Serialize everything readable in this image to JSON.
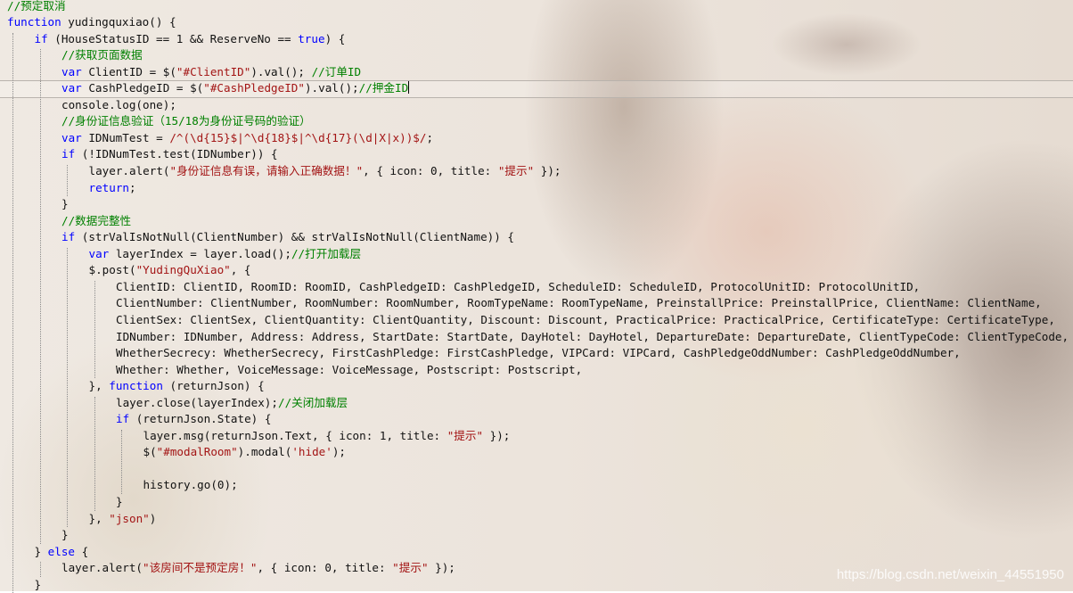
{
  "code_lines": [
    {
      "indent": 0,
      "segs": [
        {
          "t": "//预定取消",
          "c": "cm"
        }
      ]
    },
    {
      "indent": 0,
      "segs": [
        {
          "t": "function",
          "c": "kw"
        },
        {
          "t": " yudingquxiao() {",
          "c": "tx"
        }
      ]
    },
    {
      "indent": 1,
      "segs": [
        {
          "t": "if",
          "c": "kw"
        },
        {
          "t": " (HouseStatusID == 1 && ReserveNo == ",
          "c": "tx"
        },
        {
          "t": "true",
          "c": "kw"
        },
        {
          "t": ") {",
          "c": "tx"
        }
      ]
    },
    {
      "indent": 2,
      "segs": [
        {
          "t": "//获取页面数据",
          "c": "cm"
        }
      ]
    },
    {
      "indent": 2,
      "segs": [
        {
          "t": "var",
          "c": "kw"
        },
        {
          "t": " ClientID = $(",
          "c": "tx"
        },
        {
          "t": "\"#ClientID\"",
          "c": "st"
        },
        {
          "t": ").val(); ",
          "c": "tx"
        },
        {
          "t": "//订单ID",
          "c": "cm"
        }
      ]
    },
    {
      "indent": 2,
      "segs": [
        {
          "t": "var",
          "c": "kw"
        },
        {
          "t": " CashPledgeID = $(",
          "c": "tx"
        },
        {
          "t": "\"#CashPledgeID\"",
          "c": "st"
        },
        {
          "t": ").val();",
          "c": "tx"
        },
        {
          "t": "//押金ID",
          "c": "cm"
        }
      ]
    },
    {
      "indent": 2,
      "segs": [
        {
          "t": "console.log(one);",
          "c": "tx"
        }
      ]
    },
    {
      "indent": 2,
      "segs": [
        {
          "t": "//身份证信息验证（15/18为身份证号码的验证）",
          "c": "cm"
        }
      ]
    },
    {
      "indent": 2,
      "segs": [
        {
          "t": "var",
          "c": "kw"
        },
        {
          "t": " IDNumTest = ",
          "c": "tx"
        },
        {
          "t": "/^(\\d{15}$|^\\d{18}$|^\\d{17}(\\d|X|x))$/",
          "c": "st"
        },
        {
          "t": ";",
          "c": "tx"
        }
      ]
    },
    {
      "indent": 2,
      "segs": [
        {
          "t": "if",
          "c": "kw"
        },
        {
          "t": " (!IDNumTest.test(IDNumber)) {",
          "c": "tx"
        }
      ]
    },
    {
      "indent": 3,
      "segs": [
        {
          "t": "layer.alert(",
          "c": "tx"
        },
        {
          "t": "\"身份证信息有误，请输入正确数据！\"",
          "c": "st"
        },
        {
          "t": ", { icon: 0, title: ",
          "c": "tx"
        },
        {
          "t": "\"提示\"",
          "c": "st"
        },
        {
          "t": " });",
          "c": "tx"
        }
      ]
    },
    {
      "indent": 3,
      "segs": [
        {
          "t": "return",
          "c": "kw"
        },
        {
          "t": ";",
          "c": "tx"
        }
      ]
    },
    {
      "indent": 2,
      "segs": [
        {
          "t": "}",
          "c": "tx"
        }
      ]
    },
    {
      "indent": 2,
      "segs": [
        {
          "t": "//数据完整性",
          "c": "cm"
        }
      ]
    },
    {
      "indent": 2,
      "segs": [
        {
          "t": "if",
          "c": "kw"
        },
        {
          "t": " (strValIsNotNull(ClientNumber) && strValIsNotNull(ClientName)) {",
          "c": "tx"
        }
      ]
    },
    {
      "indent": 3,
      "segs": [
        {
          "t": "var",
          "c": "kw"
        },
        {
          "t": " layerIndex = layer.load();",
          "c": "tx"
        },
        {
          "t": "//打开加载层",
          "c": "cm"
        }
      ]
    },
    {
      "indent": 3,
      "segs": [
        {
          "t": "$.post(",
          "c": "tx"
        },
        {
          "t": "\"YudingQuXiao\"",
          "c": "st"
        },
        {
          "t": ", {",
          "c": "tx"
        }
      ]
    },
    {
      "indent": 4,
      "segs": [
        {
          "t": "ClientID: ClientID, RoomID: RoomID, CashPledgeID: CashPledgeID, ScheduleID: ScheduleID, ProtocolUnitID: ProtocolUnitID,",
          "c": "tx"
        }
      ]
    },
    {
      "indent": 4,
      "segs": [
        {
          "t": "ClientNumber: ClientNumber, RoomNumber: RoomNumber, RoomTypeName: RoomTypeName, PreinstallPrice: PreinstallPrice, ClientName: ClientName,",
          "c": "tx"
        }
      ]
    },
    {
      "indent": 4,
      "segs": [
        {
          "t": "ClientSex: ClientSex, ClientQuantity: ClientQuantity, Discount: Discount, PracticalPrice: PracticalPrice, CertificateType: CertificateType,",
          "c": "tx"
        }
      ]
    },
    {
      "indent": 4,
      "segs": [
        {
          "t": "IDNumber: IDNumber, Address: Address, StartDate: StartDate, DayHotel: DayHotel, DepartureDate: DepartureDate, ClientTypeCode: ClientTypeCode,",
          "c": "tx"
        }
      ]
    },
    {
      "indent": 4,
      "segs": [
        {
          "t": "WhetherSecrecy: WhetherSecrecy, FirstCashPledge: FirstCashPledge, VIPCard: VIPCard, CashPledgeOddNumber: CashPledgeOddNumber,",
          "c": "tx"
        }
      ]
    },
    {
      "indent": 4,
      "segs": [
        {
          "t": "Whether: Whether, VoiceMessage: VoiceMessage, Postscript: Postscript,",
          "c": "tx"
        }
      ]
    },
    {
      "indent": 3,
      "segs": [
        {
          "t": "}, ",
          "c": "tx"
        },
        {
          "t": "function",
          "c": "kw"
        },
        {
          "t": " (returnJson) {",
          "c": "tx"
        }
      ]
    },
    {
      "indent": 4,
      "segs": [
        {
          "t": "layer.close(layerIndex);",
          "c": "tx"
        },
        {
          "t": "//关闭加载层",
          "c": "cm"
        }
      ]
    },
    {
      "indent": 4,
      "segs": [
        {
          "t": "if",
          "c": "kw"
        },
        {
          "t": " (returnJson.State) {",
          "c": "tx"
        }
      ]
    },
    {
      "indent": 5,
      "segs": [
        {
          "t": "layer.msg(returnJson.Text, { icon: 1, title: ",
          "c": "tx"
        },
        {
          "t": "\"提示\"",
          "c": "st"
        },
        {
          "t": " });",
          "c": "tx"
        }
      ]
    },
    {
      "indent": 5,
      "segs": [
        {
          "t": "$(",
          "c": "tx"
        },
        {
          "t": "\"#modalRoom\"",
          "c": "st"
        },
        {
          "t": ").modal(",
          "c": "tx"
        },
        {
          "t": "'hide'",
          "c": "st"
        },
        {
          "t": ");",
          "c": "tx"
        }
      ]
    },
    {
      "indent": 5,
      "segs": []
    },
    {
      "indent": 5,
      "segs": [
        {
          "t": "history.go(0);",
          "c": "tx"
        }
      ]
    },
    {
      "indent": 4,
      "segs": [
        {
          "t": "}",
          "c": "tx"
        }
      ]
    },
    {
      "indent": 3,
      "segs": [
        {
          "t": "}, ",
          "c": "tx"
        },
        {
          "t": "\"json\"",
          "c": "st"
        },
        {
          "t": ")",
          "c": "tx"
        }
      ]
    },
    {
      "indent": 2,
      "segs": [
        {
          "t": "}",
          "c": "tx"
        }
      ]
    },
    {
      "indent": 1,
      "segs": [
        {
          "t": "} ",
          "c": "tx"
        },
        {
          "t": "else",
          "c": "kw"
        },
        {
          "t": " {",
          "c": "tx"
        }
      ]
    },
    {
      "indent": 2,
      "segs": [
        {
          "t": "layer.alert(",
          "c": "tx"
        },
        {
          "t": "\"该房间不是预定房！\"",
          "c": "st"
        },
        {
          "t": ", { icon: 0, title: ",
          "c": "tx"
        },
        {
          "t": "\"提示\"",
          "c": "st"
        },
        {
          "t": " });",
          "c": "tx"
        }
      ]
    },
    {
      "indent": 1,
      "segs": [
        {
          "t": "}",
          "c": "tx"
        }
      ]
    }
  ],
  "current_line": 5,
  "colors": {
    "keyword": "#0000ff",
    "comment": "#008000",
    "string": "#a31515",
    "text": "#111111"
  },
  "watermark": "https://blog.csdn.net/weixin_44551950"
}
